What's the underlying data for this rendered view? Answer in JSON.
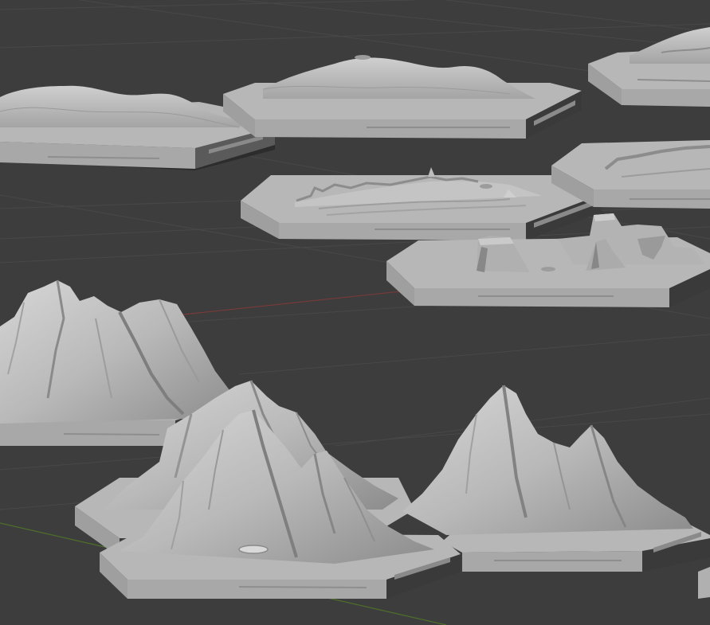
{
  "viewport": {
    "background_color": "#3d3d3d",
    "grid_color": "#484848",
    "x_axis_color": "#7a3a3a",
    "y_axis_color": "#4e6f2a",
    "tile_top_color": "#b8b8b8",
    "tile_side_color": "#9a9a9a",
    "tile_dark_color": "#2c2c2c",
    "terrain_light_color": "#d2d2d2",
    "terrain_mid_color": "#a9a9a9",
    "terrain_shadow_color": "#7f7f7f"
  },
  "tiles": [
    {
      "id": "rolling-hills-left"
    },
    {
      "id": "rolling-hills-center"
    },
    {
      "id": "rolling-hills-top-right"
    },
    {
      "id": "rocky-ridges-center"
    },
    {
      "id": "rocky-ridges-right"
    },
    {
      "id": "mesa-buttes"
    },
    {
      "id": "mountains-left"
    },
    {
      "id": "mountains-front"
    },
    {
      "id": "mountains-right"
    }
  ]
}
